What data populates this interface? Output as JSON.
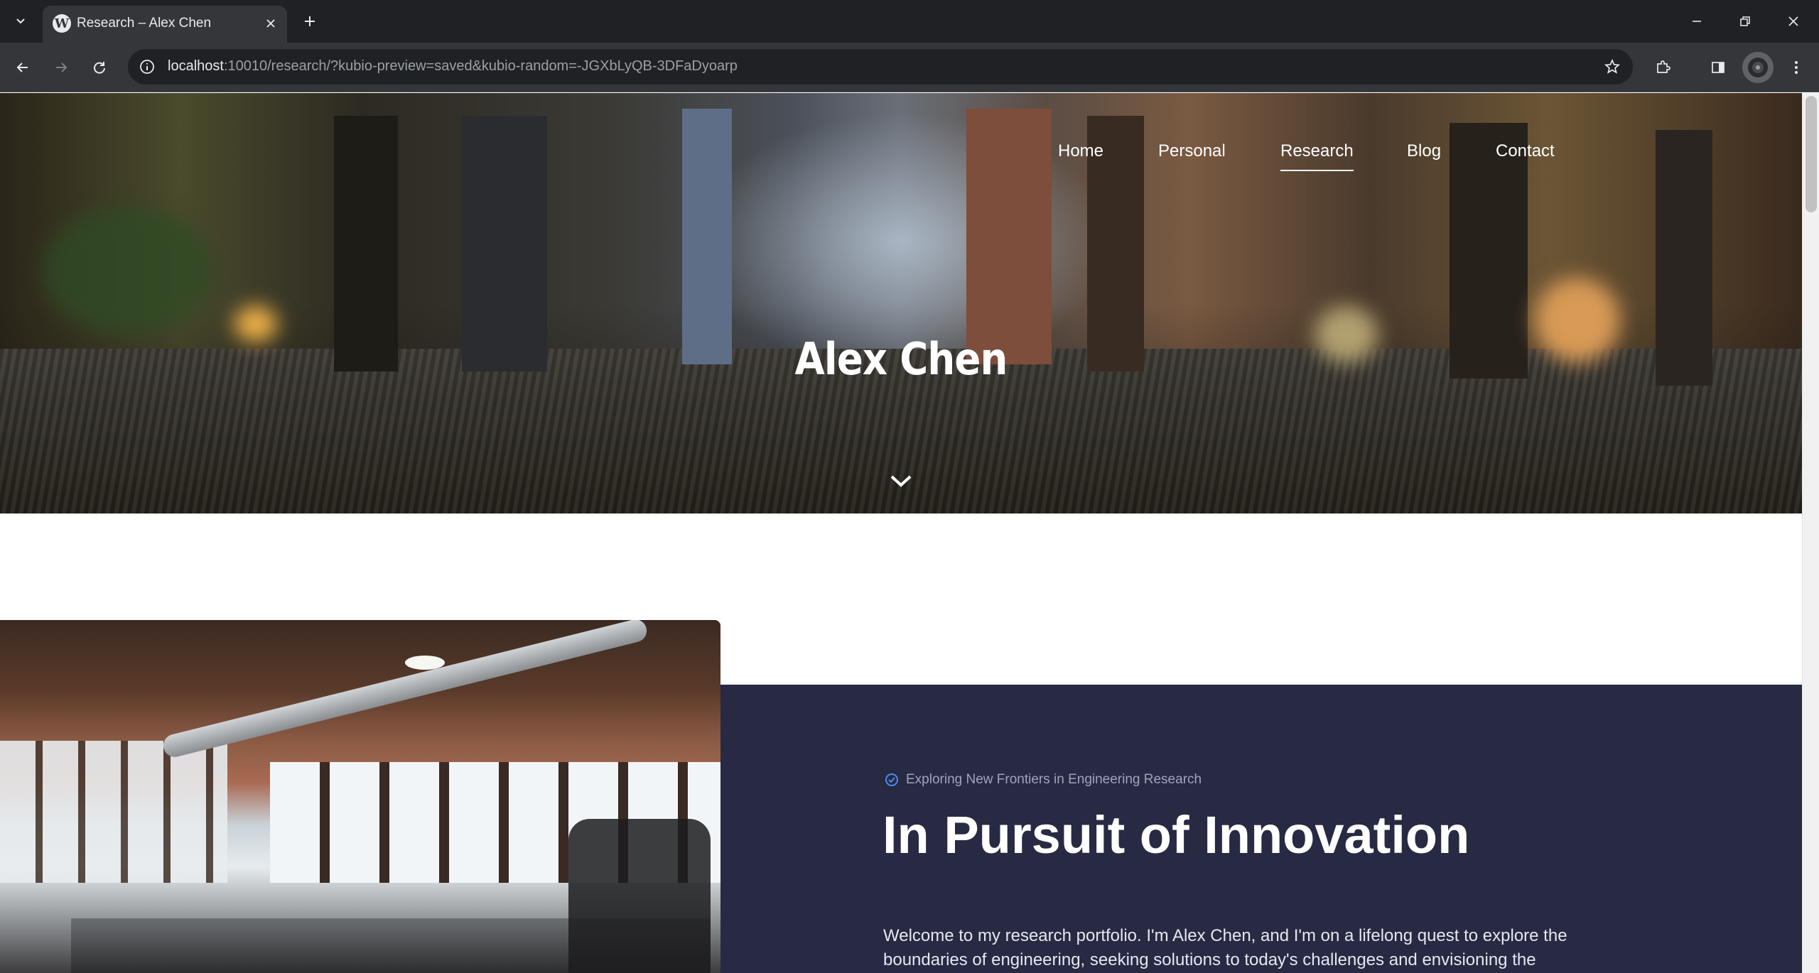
{
  "browser": {
    "tab_title": "Research – Alex Chen",
    "favicon_letter": "W",
    "url_host": "localhost",
    "url_rest": ":10010/research/?kubio-preview=saved&kubio-random=-JGXbLyQB-3DFaDyoarp"
  },
  "site": {
    "nav": [
      {
        "label": "Home",
        "active": false
      },
      {
        "label": "Personal",
        "active": false
      },
      {
        "label": "Research",
        "active": true
      },
      {
        "label": "Blog",
        "active": false
      },
      {
        "label": "Contact",
        "active": false
      }
    ],
    "hero_title": "Alex Chen"
  },
  "section": {
    "tagline": "Exploring New Frontiers in Engineering Research",
    "heading": "In Pursuit of Innovation",
    "paragraph": "Welcome to my research portfolio. I'm Alex Chen, and I'm on a lifelong quest to explore the boundaries of engineering, seeking solutions to today's challenges and envisioning the"
  },
  "colors": {
    "panel": "#272a42",
    "tagline_icon": "#4a8cf0",
    "chrome_dark": "#202124",
    "chrome_mid": "#35363a"
  }
}
